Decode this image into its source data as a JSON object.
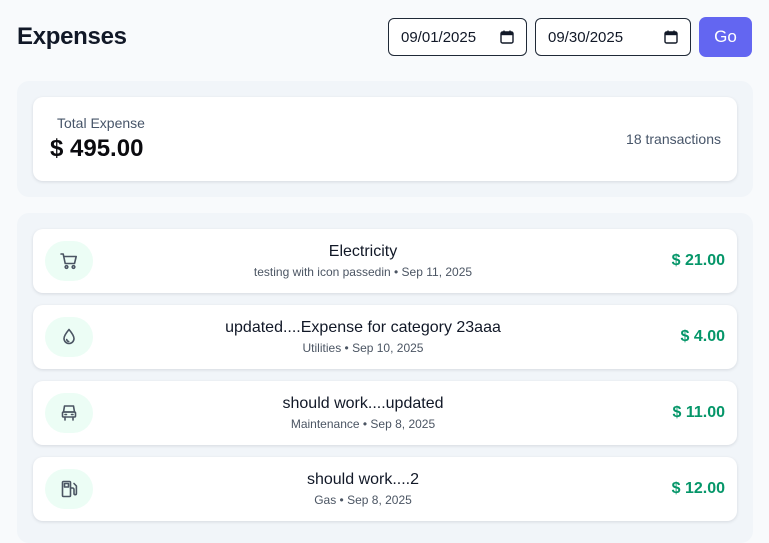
{
  "page": {
    "title": "Expenses"
  },
  "filters": {
    "start_date": "09/01/2025",
    "end_date": "09/30/2025",
    "go_label": "Go"
  },
  "summary": {
    "label": "Total Expense",
    "amount": "$ 495.00",
    "count": "18 transactions"
  },
  "colors": {
    "accent": "#6366f1",
    "amount_green": "#059669",
    "icon_bg": "#ecfdf5",
    "page_bg": "#f8fafc"
  },
  "expenses": [
    {
      "name": "Electricity",
      "category": "testing with icon passedin",
      "date": "Sep 11, 2025",
      "amount": "$ 21.00",
      "icon": "shopping-cart-icon"
    },
    {
      "name": "updated....Expense for category 23aaa",
      "category": "Utilities",
      "date": "Sep 10, 2025",
      "amount": "$ 4.00",
      "icon": "droplet-icon"
    },
    {
      "name": "should work....updated",
      "category": "Maintenance",
      "date": "Sep 8, 2025",
      "amount": "$ 11.00",
      "icon": "car-icon"
    },
    {
      "name": "should work....2",
      "category": "Gas",
      "date": "Sep 8, 2025",
      "amount": "$ 12.00",
      "icon": "fuel-pump-icon"
    }
  ]
}
